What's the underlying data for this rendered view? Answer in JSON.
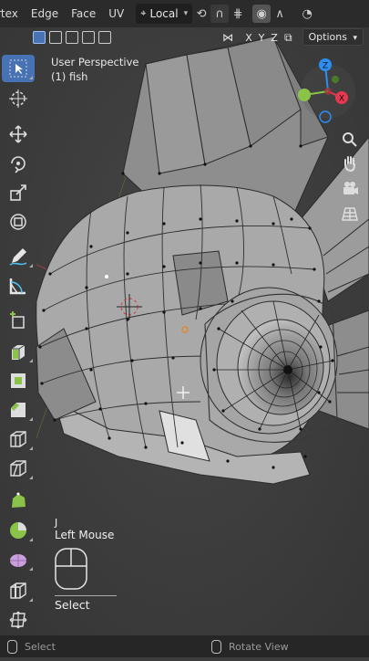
{
  "menubar": {
    "menus": [
      "rtex",
      "Edge",
      "Face",
      "UV"
    ],
    "orientation_dropdown": "Local",
    "icons": [
      "transform-orientation-icon",
      "pivot-icon",
      "snap-magnet-icon",
      "snap-grid-icon",
      "proportional-edit-icon",
      "falloff-curve-icon",
      "visibility-eye-icon"
    ]
  },
  "header_row2": {
    "selection_modes": [
      "mode-set",
      "mode-extend",
      "mode-subtract",
      "mode-invert",
      "mode-intersect"
    ],
    "mirror_axes": [
      "X",
      "Y",
      "Z"
    ],
    "options_label": "Options"
  },
  "viewport": {
    "view_name": "User Perspective",
    "object_name": "(1) fish"
  },
  "nav_gizmo": {
    "z_label": "Z",
    "x_label": "X",
    "colors": {
      "x": "#e8384f",
      "y": "#8bc34a",
      "z": "#2b8ef0"
    }
  },
  "toolbar": {
    "tools": [
      "select-box",
      "cursor",
      "move",
      "rotate",
      "scale",
      "transform",
      "annotate",
      "measure",
      "add-cube",
      "extrude-region",
      "inset-faces",
      "bevel",
      "loop-cut",
      "knife",
      "poly-build",
      "spin",
      "smooth",
      "edge-slide",
      "shrink-fatten",
      "shear"
    ]
  },
  "key_hint": {
    "key": "J",
    "button": "Left Mouse",
    "action": "Select"
  },
  "statusbar": {
    "left": "Select",
    "right": "Rotate View"
  }
}
